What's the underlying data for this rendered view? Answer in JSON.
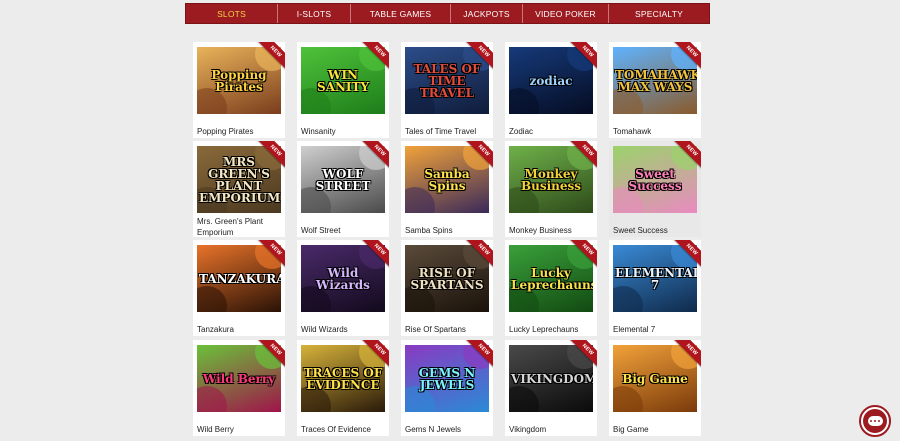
{
  "nav": {
    "items": [
      {
        "label": "SLOTS",
        "active": true
      },
      {
        "label": "I-SLOTS",
        "active": false
      },
      {
        "label": "TABLE GAMES",
        "active": false
      },
      {
        "label": "JACKPOTS",
        "active": false
      },
      {
        "label": "VIDEO POKER",
        "active": false
      },
      {
        "label": "SPECIALTY",
        "active": false
      }
    ]
  },
  "badge_label": "NEW",
  "games": [
    {
      "title": "Popping Pirates",
      "logo": "Popping Pirates",
      "colors": [
        "#e9b35a",
        "#7a3d1d"
      ],
      "logo_color": "#ffd23f",
      "new": true
    },
    {
      "title": "Winsanity",
      "logo": "WIN SANITY",
      "colors": [
        "#4fc23a",
        "#1d7d1a"
      ],
      "logo_color": "#f7e53b",
      "new": true
    },
    {
      "title": "Tales of Time Travel",
      "logo": "TALES OF TIME TRAVEL",
      "colors": [
        "#2c4d8a",
        "#0f1c3a"
      ],
      "logo_color": "#e34b3a",
      "new": true
    },
    {
      "title": "Zodiac",
      "logo": "zodiac",
      "colors": [
        "#163a7a",
        "#050c22"
      ],
      "logo_color": "#9fd3ff",
      "new": true
    },
    {
      "title": "Tomahawk",
      "logo": "TOMAHAWK MAX WAYS",
      "colors": [
        "#5fb3ff",
        "#8a5a2a"
      ],
      "logo_color": "#f2c23a",
      "new": true
    },
    {
      "title": "Mrs. Green's Plant Emporium",
      "logo": "MRS GREEN'S PLANT EMPORIUM",
      "colors": [
        "#8a6a3a",
        "#4a3820"
      ],
      "logo_color": "#f4e7c4",
      "new": true
    },
    {
      "title": "Wolf Street",
      "logo": "WOLF STREET",
      "colors": [
        "#cfcfcf",
        "#4a4a4a"
      ],
      "logo_color": "#ffffff",
      "new": true
    },
    {
      "title": "Samba Spins",
      "logo": "Samba Spins",
      "colors": [
        "#f1a23a",
        "#3a2a5a"
      ],
      "logo_color": "#ffe14a",
      "new": true
    },
    {
      "title": "Monkey Business",
      "logo": "Monkey Business",
      "colors": [
        "#6fb14a",
        "#2e4a1a"
      ],
      "logo_color": "#f2d43a",
      "new": true
    },
    {
      "title": "Sweet Success",
      "logo": "Sweet Success",
      "colors": [
        "#9ad36a",
        "#e98ac0"
      ],
      "logo_color": "#ff7fb8",
      "new": true
    },
    {
      "title": "Tanzakura",
      "logo": "TANZAKURA",
      "colors": [
        "#e8732a",
        "#2a1206"
      ],
      "logo_color": "#ffffff",
      "new": true
    },
    {
      "title": "Wild Wizards",
      "logo": "Wild Wizards",
      "colors": [
        "#4a2a6a",
        "#120a1c"
      ],
      "logo_color": "#d6b6ff",
      "new": true
    },
    {
      "title": "Rise Of Spartans",
      "logo": "RISE OF SPARTANS",
      "colors": [
        "#5a4a3a",
        "#1a120a"
      ],
      "logo_color": "#f0e0c0",
      "new": true
    },
    {
      "title": "Lucky Leprechauns",
      "logo": "Lucky Leprechauns",
      "colors": [
        "#3aa03a",
        "#124a12"
      ],
      "logo_color": "#f6e34a",
      "new": true
    },
    {
      "title": "Elemental 7",
      "logo": "ELEMENTAL 7",
      "colors": [
        "#3a8ad6",
        "#0f2a4a"
      ],
      "logo_color": "#e8f4ff",
      "new": true
    },
    {
      "title": "Wild Berry",
      "logo": "Wild Berry",
      "colors": [
        "#6ac13a",
        "#a0144a"
      ],
      "logo_color": "#ff3a7a",
      "new": true
    },
    {
      "title": "Traces Of Evidence",
      "logo": "TRACES OF EVIDENCE",
      "colors": [
        "#d6b23a",
        "#2a1a0a"
      ],
      "logo_color": "#ffe14a",
      "new": true
    },
    {
      "title": "Gems N Jewels",
      "logo": "GEMS N JEWELS",
      "colors": [
        "#8a3ac1",
        "#2a8ad6"
      ],
      "logo_color": "#7af2ff",
      "new": true
    },
    {
      "title": "Vikingdom",
      "logo": "VIKINGDOM",
      "colors": [
        "#4a4a4a",
        "#0a0a0a"
      ],
      "logo_color": "#d6d6d6",
      "new": true
    },
    {
      "title": "Big Game",
      "logo": "Big Game",
      "colors": [
        "#f2a23a",
        "#7a3a0a"
      ],
      "logo_color": "#ffe14a",
      "new": true
    }
  ],
  "highlighted_game": "Sweet Success",
  "chat": {
    "icon": "chat-bubble-icon"
  }
}
